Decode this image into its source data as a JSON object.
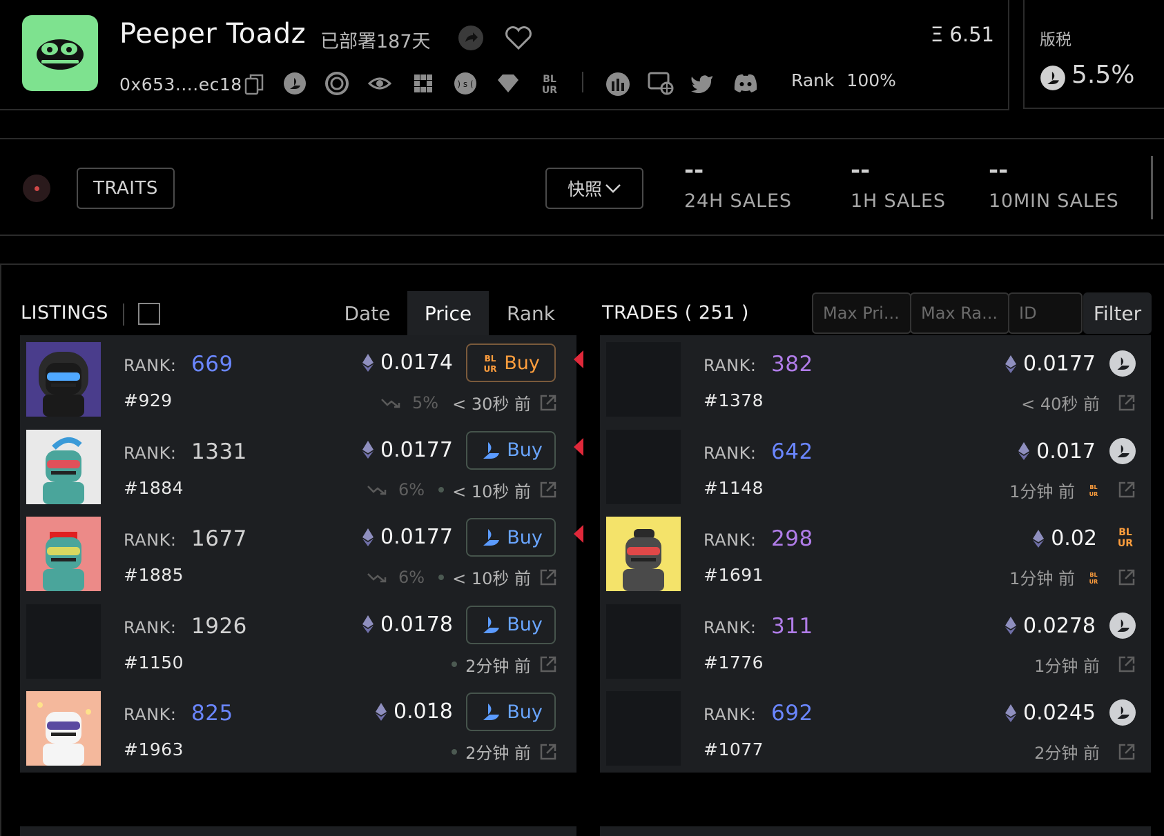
{
  "collection": {
    "name": "Peeper Toadz",
    "deployed": "已部署187天",
    "address": "0x653....ec18",
    "floor_price": "Ξ 6.51",
    "rank_label": "Rank",
    "rank_value": "100%",
    "royalty_label": "版税",
    "royalty_value": "5.5%"
  },
  "header_icons": [
    "share-icon",
    "heart-icon",
    "copy-icon",
    "opensea-icon",
    "looksrare-icon",
    "x2y2-icon",
    "element-icon",
    "sudoswap-icon",
    "gem-icon",
    "blur-icon",
    "nftgo-icon",
    "website-icon",
    "twitter-icon",
    "discord-icon"
  ],
  "stats": {
    "traits_label": "TRAITS",
    "snapshot_label": "快照",
    "sales_24h_value": "--",
    "sales_24h_label": "24H SALES",
    "sales_1h_value": "--",
    "sales_1h_label": "1H SALES",
    "sales_10min_value": "--",
    "sales_10min_label": "10MIN SALES"
  },
  "listings": {
    "label": "LISTINGS",
    "sort_tabs": [
      "Date",
      "Price",
      "Rank"
    ],
    "active_sort": "Price",
    "rank_prefix": "RANK:",
    "buy_label": "Buy",
    "items": [
      {
        "rank": "669",
        "rank_color": "#6a86ff",
        "id": "#929",
        "price": "0.0174",
        "market": "blur",
        "change": "5%",
        "time": "< 30秒 前",
        "flag": true,
        "has_dot": false
      },
      {
        "rank": "1331",
        "rank_color": "#d2d2d2",
        "id": "#1884",
        "price": "0.0177",
        "market": "opensea",
        "change": "6%",
        "time": "< 10秒 前",
        "flag": true,
        "has_dot": true
      },
      {
        "rank": "1677",
        "rank_color": "#d2d2d2",
        "id": "#1885",
        "price": "0.0177",
        "market": "opensea",
        "change": "6%",
        "time": "< 10秒 前",
        "flag": true,
        "has_dot": true
      },
      {
        "rank": "1926",
        "rank_color": "#d2d2d2",
        "id": "#1150",
        "price": "0.0178",
        "market": "opensea",
        "change": "",
        "time": "2分钟 前",
        "flag": false,
        "has_dot": true
      },
      {
        "rank": "825",
        "rank_color": "#6a86ff",
        "id": "#1963",
        "price": "0.018",
        "market": "opensea",
        "change": "",
        "time": "2分钟 前",
        "flag": false,
        "has_dot": true
      }
    ]
  },
  "trades": {
    "label": "TRADES ( 251 )",
    "filters": {
      "max_price_placeholder": "Max Pri...",
      "max_rank_placeholder": "Max Ra...",
      "id_placeholder": "ID",
      "filter_label": "Filter"
    },
    "items": [
      {
        "rank": "382",
        "rank_color": "#b07ce8",
        "id": "#1378",
        "price": "0.0177",
        "source": "opensea",
        "time": "< 40秒 前",
        "blur_tag": false
      },
      {
        "rank": "642",
        "rank_color": "#6a86ff",
        "id": "#1148",
        "price": "0.017",
        "source": "opensea",
        "time": "1分钟 前",
        "blur_tag": true
      },
      {
        "rank": "298",
        "rank_color": "#b07ce8",
        "id": "#1691",
        "price": "0.02",
        "source": "blur",
        "time": "1分钟 前",
        "blur_tag": true
      },
      {
        "rank": "311",
        "rank_color": "#b07ce8",
        "id": "#1776",
        "price": "0.0278",
        "source": "opensea",
        "time": "1分钟 前",
        "blur_tag": false
      },
      {
        "rank": "692",
        "rank_color": "#6a86ff",
        "id": "#1077",
        "price": "0.0245",
        "source": "opensea",
        "time": "2分钟 前",
        "blur_tag": false
      }
    ]
  },
  "colors": {
    "accent_green": "#7ee28f",
    "blur_orange": "#ff9e3d",
    "opensea_blue": "#69a5ff",
    "flag_red": "#e0283a"
  }
}
